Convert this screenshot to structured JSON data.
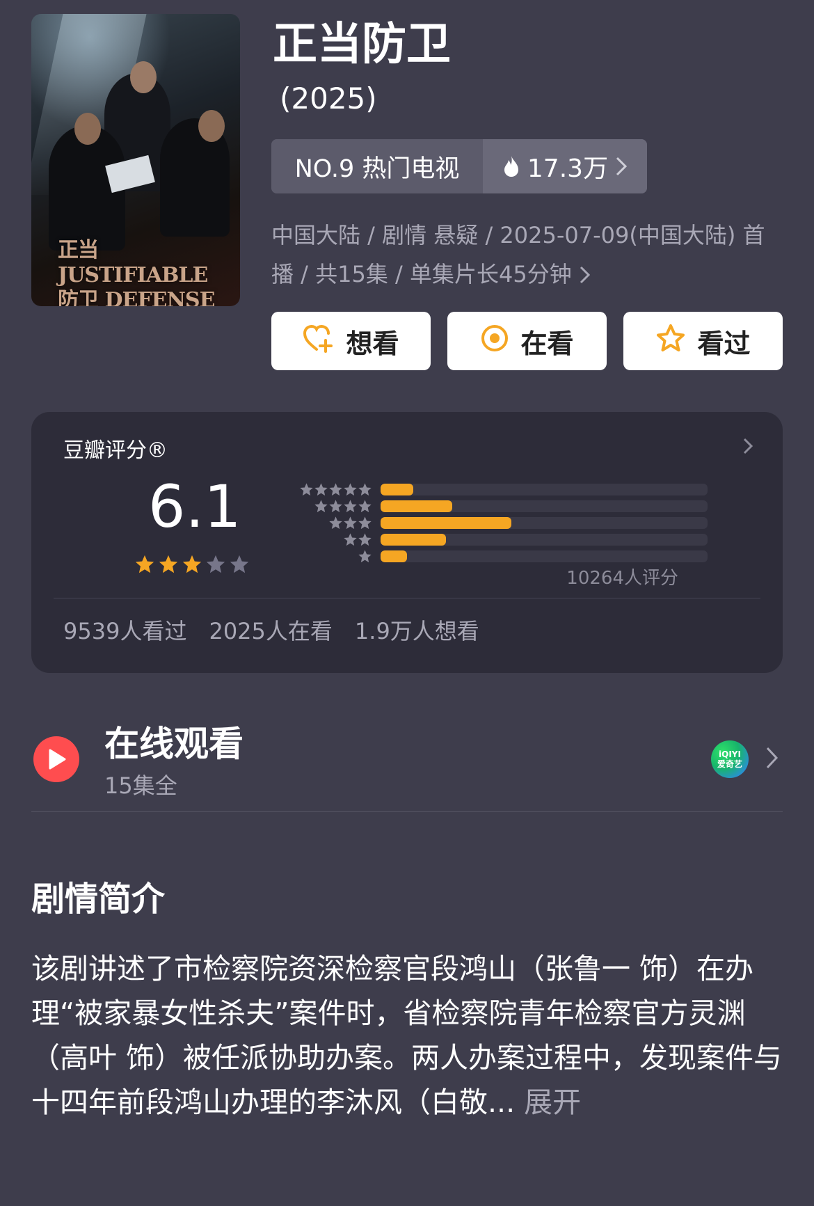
{
  "poster": {
    "alt": "正当防卫 poster",
    "title_cn": "正当",
    "title_cn2": "防卫",
    "title_en": "JUSTIFIABLE",
    "title_en2": "DEFENSE"
  },
  "title": "正当防卫",
  "year": "(2025)",
  "rank": {
    "label": "NO.9 热门电视",
    "heat": "17.3万",
    "icon": "flame-icon"
  },
  "meta": "中国大陆 / 剧情 悬疑 / 2025-07-09(中国大陆) 首播 / 共15集 / 单集片长45分钟",
  "actions": [
    {
      "label": "想看",
      "icon": "heart-plus-icon"
    },
    {
      "label": "在看",
      "icon": "target-icon"
    },
    {
      "label": "看过",
      "icon": "star-icon"
    }
  ],
  "rating": {
    "label": "豆瓣评分®",
    "score": "6.1",
    "stars": 3,
    "distribution": [
      {
        "stars": 5,
        "fraction": 0.1
      },
      {
        "stars": 4,
        "fraction": 0.22
      },
      {
        "stars": 3,
        "fraction": 0.4
      },
      {
        "stars": 2,
        "fraction": 0.2
      },
      {
        "stars": 1,
        "fraction": 0.08
      }
    ],
    "count": "10264人评分",
    "stats": [
      "9539人看过",
      "2025人在看",
      "1.9万人想看"
    ]
  },
  "watch": {
    "title": "在线观看",
    "subtitle": "15集全",
    "provider_top": "iQIYI",
    "provider_bottom": "爱奇艺"
  },
  "synopsis": {
    "title": "剧情简介",
    "text": "该剧讲述了市检察院资深检察官段鸿山（张鲁一 饰）在办理“被家暴女性杀夫”案件时，省检察院青年检察官方灵渊（高叶 饰）被任派协助办案。两人办案过程中，发现案件与十四年前段鸿山办理的李沐风（白敬...",
    "expand_label": "展开"
  },
  "colors": {
    "background": "#3e3d4c",
    "card": "#2d2c39",
    "accent_orange": "#f5a623",
    "play_red": "#ff4d4f"
  }
}
